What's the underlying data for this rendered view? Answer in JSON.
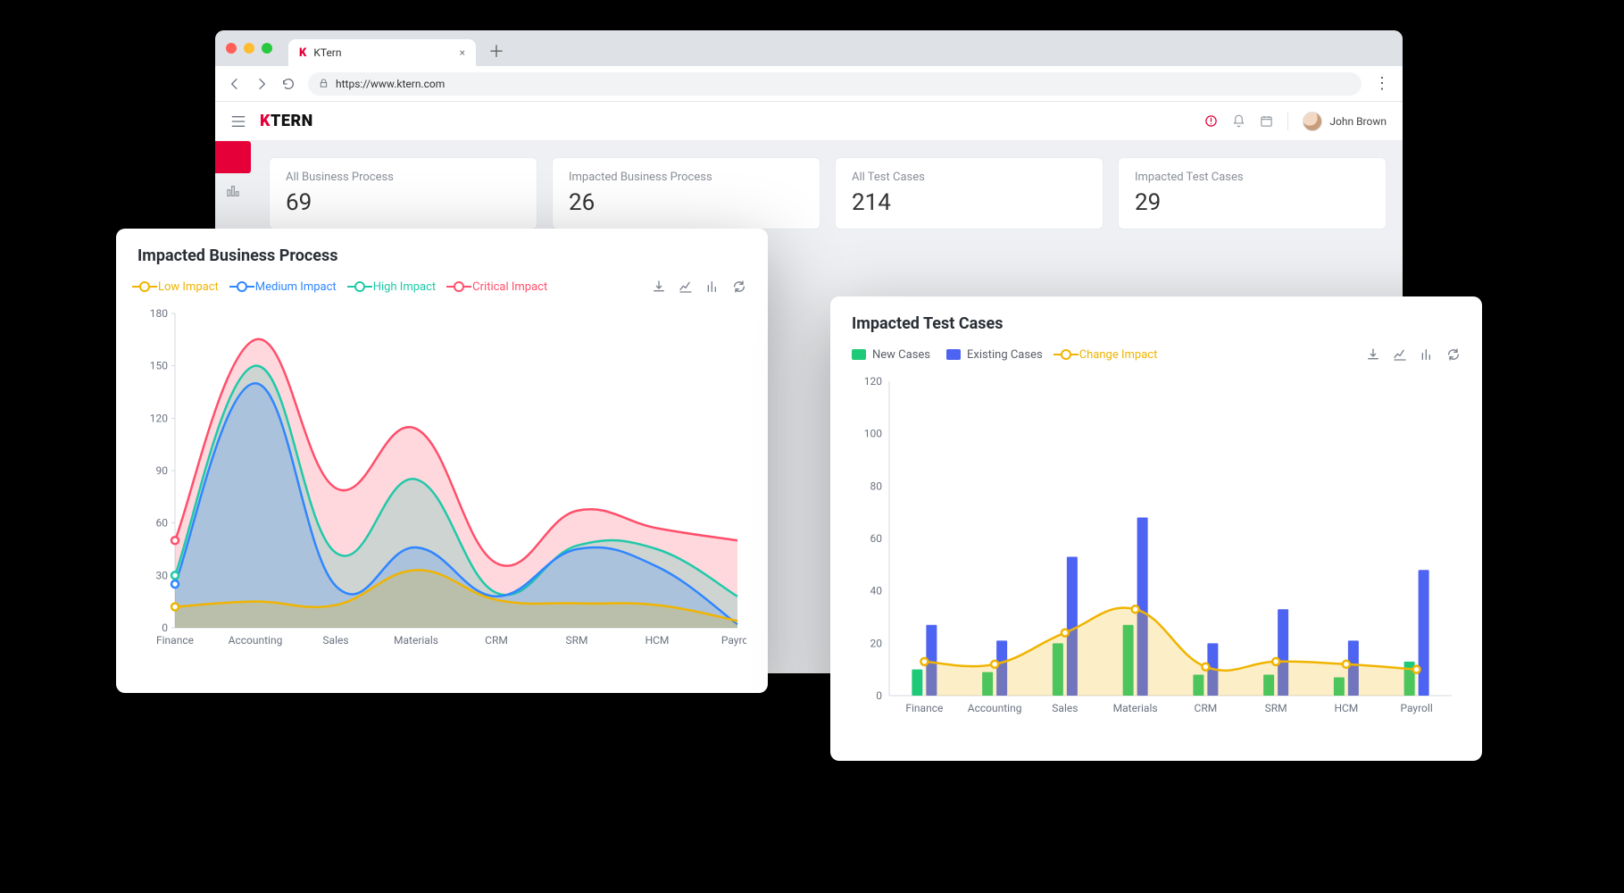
{
  "browser": {
    "tab_title": "KTern",
    "url": "https://www.ktern.com"
  },
  "app": {
    "logo_prefix": "K",
    "logo_suffix": "TERN",
    "user_name": "John Brown"
  },
  "stats": [
    {
      "label": "All Business Process",
      "value": "69"
    },
    {
      "label": "Impacted Business Process",
      "value": "26"
    },
    {
      "label": "All Test Cases",
      "value": "214"
    },
    {
      "label": "Impacted Test Cases",
      "value": "29"
    }
  ],
  "chart_left": {
    "title": "Impacted Business Process",
    "legend": [
      "Low Impact",
      "Medium Impact",
      "High Impact",
      "Critical Impact"
    ]
  },
  "chart_right": {
    "title": "Impacted Test Cases",
    "legend": [
      "New Cases",
      "Existing Cases",
      "Change Impact"
    ]
  },
  "chart_data": [
    {
      "type": "area",
      "title": "Impacted Business Process",
      "xlabel": "",
      "ylabel": "",
      "ylim": [
        0,
        180
      ],
      "categories": [
        "Finance",
        "Accounting",
        "Sales",
        "Materials",
        "CRM",
        "SRM",
        "HCM",
        "Payroll"
      ],
      "series": [
        {
          "name": "Low Impact",
          "values": [
            12,
            15,
            13,
            33,
            16,
            14,
            13,
            4
          ],
          "color": "#f0b400"
        },
        {
          "name": "Medium Impact",
          "values": [
            25,
            140,
            24,
            46,
            18,
            45,
            35,
            2
          ],
          "color": "#2f86ff"
        },
        {
          "name": "High Impact",
          "values": [
            30,
            150,
            43,
            85,
            20,
            47,
            45,
            18
          ],
          "color": "#20c9a8"
        },
        {
          "name": "Critical Impact",
          "values": [
            50,
            165,
            80,
            114,
            37,
            67,
            57,
            50
          ],
          "color": "#ff4f6a"
        }
      ]
    },
    {
      "type": "bar+line",
      "title": "Impacted Test Cases",
      "xlabel": "",
      "ylabel": "",
      "ylim": [
        0,
        120
      ],
      "categories": [
        "Finance",
        "Accounting",
        "Sales",
        "Materials",
        "CRM",
        "SRM",
        "HCM",
        "Payroll"
      ],
      "series": [
        {
          "name": "New Cases",
          "kind": "bar",
          "values": [
            10,
            9,
            20,
            27,
            8,
            8,
            7,
            13
          ],
          "color": "#1ec977"
        },
        {
          "name": "Existing Cases",
          "kind": "bar",
          "values": [
            27,
            21,
            53,
            68,
            20,
            33,
            21,
            48
          ],
          "color": "#4d63f2"
        },
        {
          "name": "Change Impact",
          "kind": "line",
          "values": [
            13,
            12,
            24,
            33,
            11,
            13,
            12,
            10
          ],
          "color": "#f0b400"
        }
      ]
    }
  ]
}
